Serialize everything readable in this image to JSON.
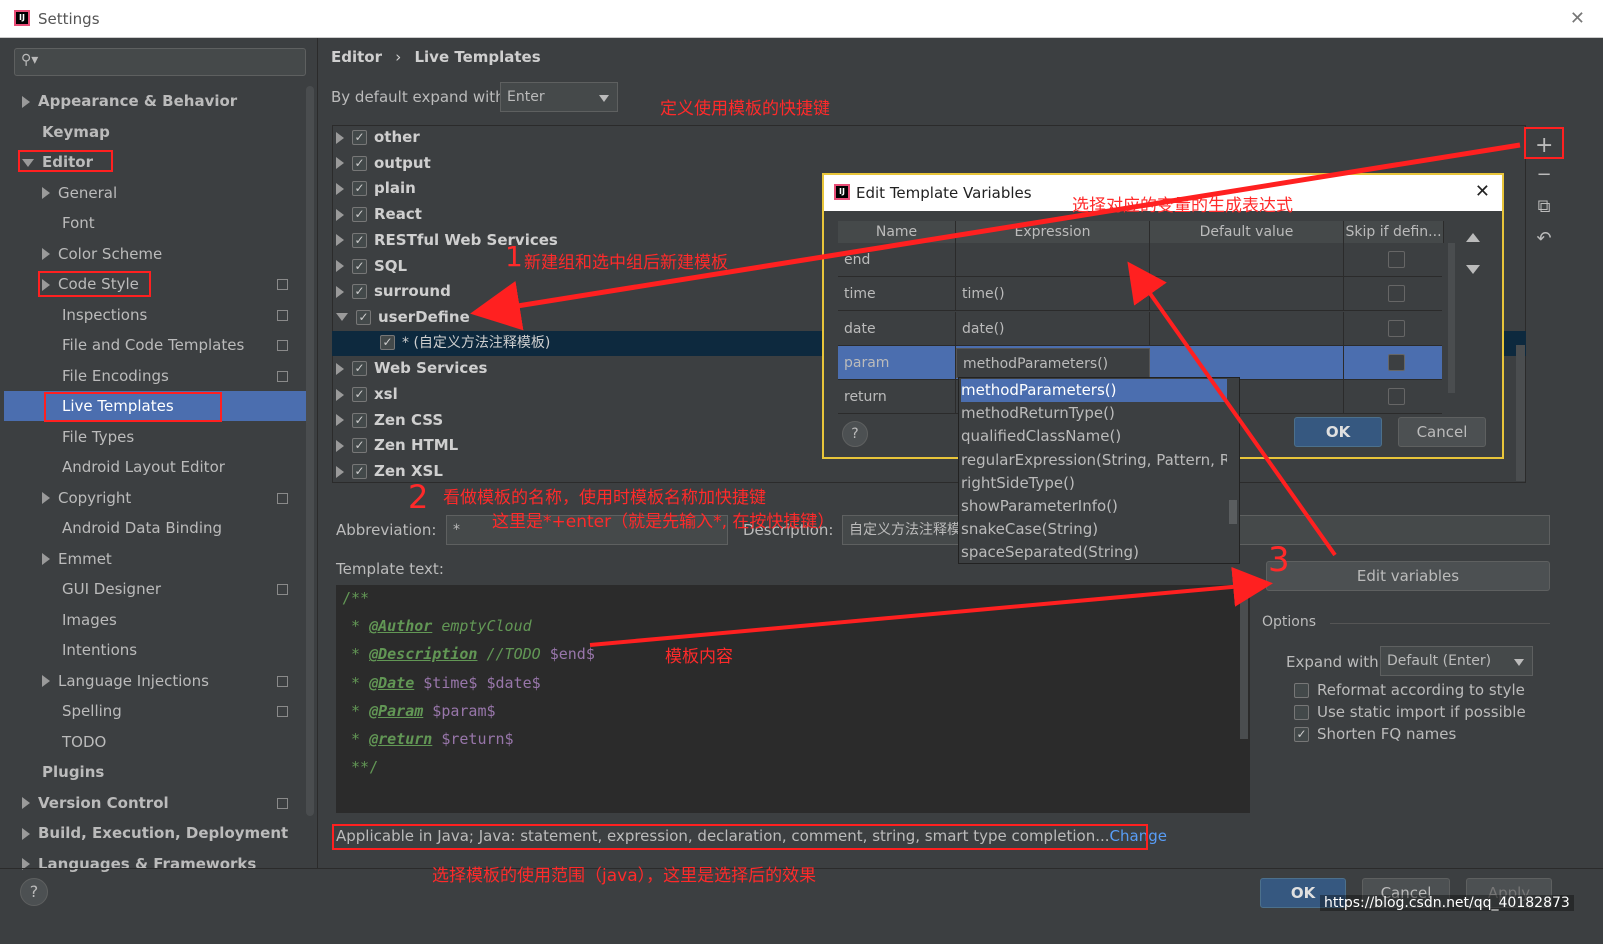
{
  "window": {
    "title": "Settings",
    "close": "✕"
  },
  "sidebar": {
    "search_placeholder": "",
    "items": [
      {
        "label": "Appearance & Behavior",
        "level": 0,
        "bold": true,
        "expand": "collapsed"
      },
      {
        "label": "Keymap",
        "level": 0,
        "bold": true,
        "expand": "none"
      },
      {
        "label": "Editor",
        "level": 0,
        "bold": true,
        "expand": "expanded"
      },
      {
        "label": "General",
        "level": 1,
        "expand": "collapsed"
      },
      {
        "label": "Font",
        "level": 1,
        "expand": "none"
      },
      {
        "label": "Color Scheme",
        "level": 1,
        "expand": "collapsed"
      },
      {
        "label": "Code Style",
        "level": 1,
        "expand": "collapsed",
        "copy": true
      },
      {
        "label": "Inspections",
        "level": 1,
        "expand": "none",
        "copy": true
      },
      {
        "label": "File and Code Templates",
        "level": 1,
        "expand": "none",
        "copy": true
      },
      {
        "label": "File Encodings",
        "level": 1,
        "expand": "none",
        "copy": true
      },
      {
        "label": "Live Templates",
        "level": 1,
        "expand": "none",
        "selected": true
      },
      {
        "label": "File Types",
        "level": 1,
        "expand": "none"
      },
      {
        "label": "Android Layout Editor",
        "level": 1,
        "expand": "none"
      },
      {
        "label": "Copyright",
        "level": 1,
        "expand": "collapsed",
        "copy": true
      },
      {
        "label": "Android Data Binding",
        "level": 1,
        "expand": "none"
      },
      {
        "label": "Emmet",
        "level": 1,
        "expand": "collapsed"
      },
      {
        "label": "GUI Designer",
        "level": 1,
        "expand": "none",
        "copy": true
      },
      {
        "label": "Images",
        "level": 1,
        "expand": "none"
      },
      {
        "label": "Intentions",
        "level": 1,
        "expand": "none"
      },
      {
        "label": "Language Injections",
        "level": 1,
        "expand": "collapsed",
        "copy": true
      },
      {
        "label": "Spelling",
        "level": 1,
        "expand": "none",
        "copy": true
      },
      {
        "label": "TODO",
        "level": 1,
        "expand": "none"
      },
      {
        "label": "Plugins",
        "level": 0,
        "bold": true,
        "expand": "none"
      },
      {
        "label": "Version Control",
        "level": 0,
        "bold": true,
        "expand": "collapsed",
        "copy": true
      },
      {
        "label": "Build, Execution, Deployment",
        "level": 0,
        "bold": true,
        "expand": "collapsed"
      },
      {
        "label": "Languages & Frameworks",
        "level": 0,
        "bold": true,
        "expand": "collapsed"
      }
    ]
  },
  "breadcrumb": {
    "parent": "Editor",
    "sep": "›",
    "current": "Live Templates"
  },
  "expand_with": {
    "label": "By default expand with",
    "value": "Enter"
  },
  "groups": [
    {
      "label": "other",
      "checked": true,
      "expanded": false
    },
    {
      "label": "output",
      "checked": true,
      "expanded": false
    },
    {
      "label": "plain",
      "checked": true,
      "expanded": false
    },
    {
      "label": "React",
      "checked": true,
      "expanded": false
    },
    {
      "label": "RESTful Web Services",
      "checked": true,
      "expanded": false
    },
    {
      "label": "SQL",
      "checked": true,
      "expanded": false
    },
    {
      "label": "surround",
      "checked": true,
      "expanded": false
    },
    {
      "label": "userDefine",
      "checked": true,
      "expanded": true
    },
    {
      "label": "* (自定义方法注释模板)",
      "checked": true,
      "child": true
    },
    {
      "label": "Web Services",
      "checked": true,
      "expanded": false
    },
    {
      "label": "xsl",
      "checked": true,
      "expanded": false
    },
    {
      "label": "Zen CSS",
      "checked": true,
      "expanded": false
    },
    {
      "label": "Zen HTML",
      "checked": true,
      "expanded": false
    },
    {
      "label": "Zen XSL",
      "checked": true,
      "expanded": false
    }
  ],
  "toolbar": {
    "add": "+",
    "remove": "−",
    "copy": "⧉",
    "revert": "↶"
  },
  "abbreviation": {
    "label": "Abbreviation:",
    "value": "*"
  },
  "description": {
    "label": "Description:",
    "value": "自定义方法注释模板"
  },
  "template_text": {
    "label": "Template text:",
    "lines": [
      {
        "prefix": "/**"
      },
      {
        "prefix": " * ",
        "tag": "@Author",
        "rest": " emptyCloud",
        "rest_type": "it"
      },
      {
        "prefix": " * ",
        "tag": "@Description",
        "rest": " //TODO ",
        "rest_type": "it",
        "var": "$end$"
      },
      {
        "prefix": " * ",
        "tag": "@Date",
        "var": " $time$ $date$"
      },
      {
        "prefix": " * ",
        "tag": "@Param",
        "var": " $param$"
      },
      {
        "prefix": " * ",
        "tag": "@return",
        "var": " $return$"
      },
      {
        "prefix": " **/"
      }
    ]
  },
  "applicable": {
    "text": "Applicable in Java; Java: statement, expression, declaration, comment, string, smart type completion...",
    "link": "Change"
  },
  "edit_variables_button": "Edit variables",
  "options": {
    "title": "Options",
    "expand_label": "Expand with",
    "expand_value": "Default (Enter)",
    "checks": [
      {
        "label": "Reformat according to style",
        "checked": false
      },
      {
        "label": "Use static import if possible",
        "checked": false
      },
      {
        "label": "Shorten FQ names",
        "checked": true
      }
    ]
  },
  "footer": {
    "ok": "OK",
    "cancel": "Cancel",
    "apply": "Apply",
    "help": "?"
  },
  "dialog": {
    "title": "Edit Template Variables",
    "close": "✕",
    "columns": [
      "Name",
      "Expression",
      "Default value",
      "Skip if defin..."
    ],
    "rows": [
      {
        "name": "end",
        "expression": "",
        "default": "",
        "skip": false
      },
      {
        "name": "time",
        "expression": "time()",
        "default": "",
        "skip": false
      },
      {
        "name": "date",
        "expression": "date()",
        "default": "",
        "skip": false
      },
      {
        "name": "param",
        "expression": "methodParameters()",
        "default": "",
        "skip": false,
        "selected": true
      },
      {
        "name": "return",
        "expression": "",
        "default": "",
        "skip": false
      }
    ],
    "ok": "OK",
    "cancel": "Cancel",
    "help": "?",
    "dropdown": [
      "methodParameters()",
      "methodReturnType()",
      "qualifiedClassName()",
      "regularExpression(String, Pattern, Rep",
      "rightSideType()",
      "showParameterInfo()",
      "snakeCase(String)",
      "spaceSeparated(String)"
    ]
  },
  "annotations": {
    "shortcut": "定义使用模板的快捷键",
    "new_group": "新建组和选中组后新建模板",
    "mark1": "1",
    "name_hint": "看做模板的名称，使用时模板名称加快捷键",
    "name_hint2": "这里是*+enter（就是先输入*, 在按快捷键）",
    "mark2": "2",
    "content": "模板内容",
    "mark3": "3",
    "expr": "选择对应的变量的生成表达式",
    "scope": "选择模板的使用范围（java），这里是选择后的效果"
  },
  "watermark": "https://blog.csdn.net/qq_40182873",
  "colors": {
    "accent": "#4b6eaf",
    "annotation": "#ff2020",
    "dialog_border": "#e8c53a",
    "link": "#589df6"
  }
}
